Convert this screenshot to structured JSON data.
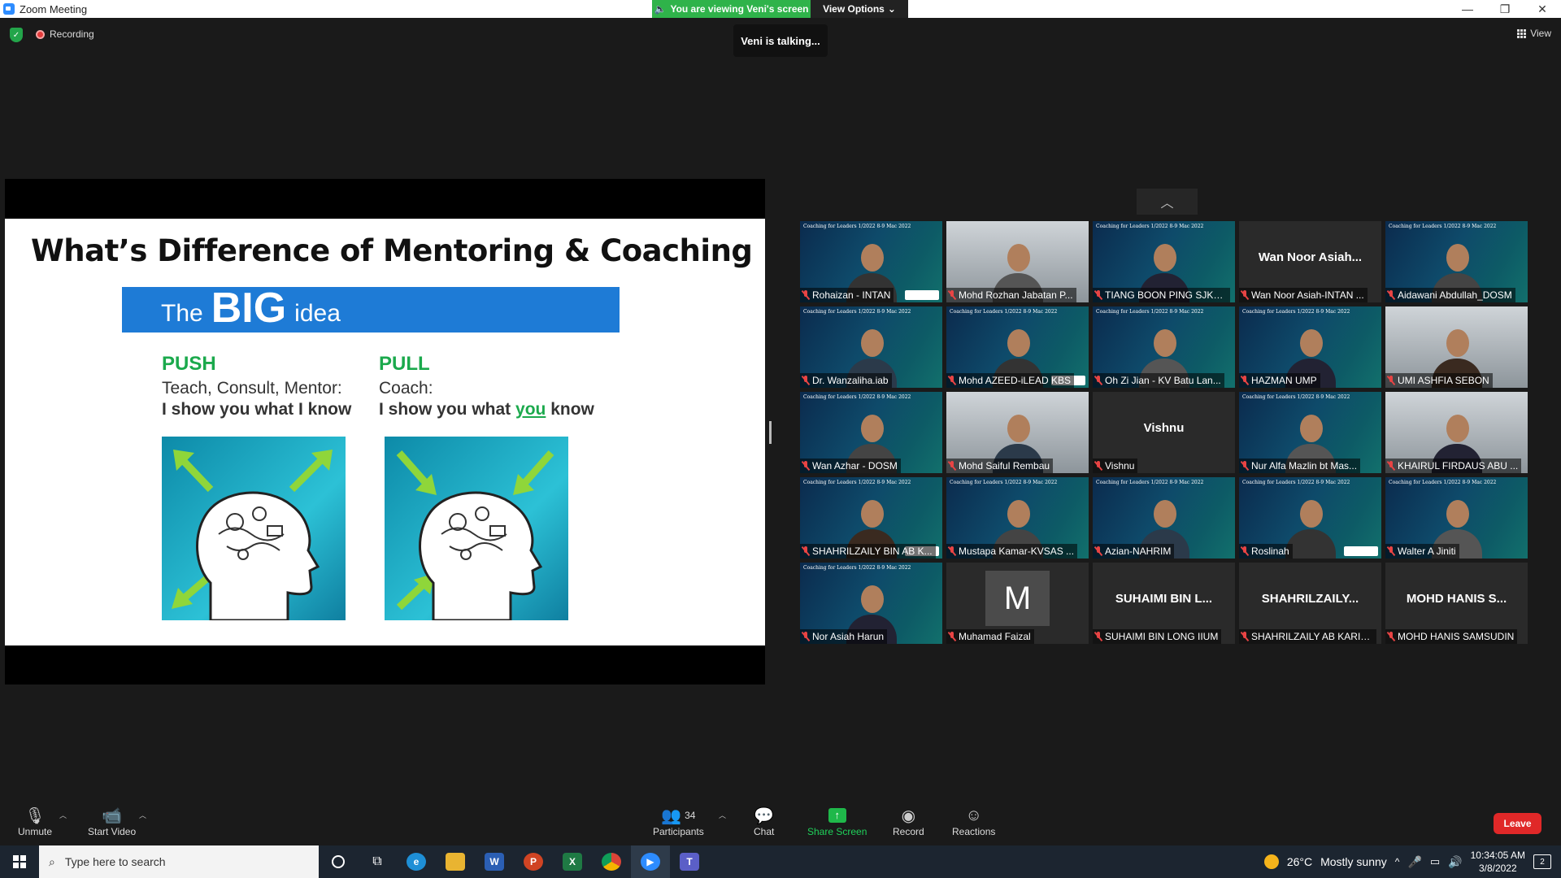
{
  "window": {
    "title": "Zoom Meeting"
  },
  "banner": {
    "viewing_text": "You are viewing Veni's screen",
    "view_options_label": "View Options"
  },
  "status": {
    "recording_label": "Recording",
    "talking_text": "Veni is talking...",
    "view_label": "View"
  },
  "slide": {
    "title": "What’s Difference of Mentoring & Coaching",
    "big_idea": {
      "the": "The",
      "big": "BIG",
      "idea": "idea"
    },
    "push": {
      "head": "PUSH",
      "line1": "Teach, Consult, Mentor:",
      "line2": "I show you what I know"
    },
    "pull": {
      "head": "PULL",
      "line1": "Coach:",
      "line2_pre": "I show you what ",
      "line2_hl": "you",
      "line2_post": " know"
    },
    "banner_text": "Coaching for Leaders 1/2022 8-9 Mac 2022"
  },
  "participants": [
    {
      "name": "Rohaizan - INTAN",
      "style": "bg"
    },
    {
      "name": "Mohd Rozhan Jabatan P...",
      "style": "cam"
    },
    {
      "name": "TIANG BOON PING SJKC...",
      "style": "bg"
    },
    {
      "name": "Wan Noor Asiah-INTAN ...",
      "style": "name",
      "display": "Wan Noor Asiah..."
    },
    {
      "name": "Aidawani Abdullah_DOSM",
      "style": "bg"
    },
    {
      "name": "Dr. Wanzaliha.iab",
      "style": "bg",
      "mic": false
    },
    {
      "name": "Mohd AZEED-iLEAD KBS",
      "style": "bg"
    },
    {
      "name": "Oh Zi Jian - KV Batu Lan...",
      "style": "bg"
    },
    {
      "name": "HAZMAN UMP",
      "style": "bg"
    },
    {
      "name": "UMI ASHFIA SEBON",
      "style": "cam"
    },
    {
      "name": "Wan Azhar - DOSM",
      "style": "bg"
    },
    {
      "name": "Mohd Saiful Rembau",
      "style": "cam"
    },
    {
      "name": "Vishnu",
      "style": "name",
      "display": "Vishnu"
    },
    {
      "name": "Nur Alfa Mazlin bt Mas...",
      "style": "bg"
    },
    {
      "name": "KHAIRUL FIRDAUS ABU ...",
      "style": "cam"
    },
    {
      "name": "SHAHRILZAILY BIN AB K...",
      "style": "bg"
    },
    {
      "name": "Mustapa Kamar-KVSAS ...",
      "style": "bg"
    },
    {
      "name": "Azian-NAHRIM",
      "style": "bg",
      "mic": false
    },
    {
      "name": "Roslinah",
      "style": "bg"
    },
    {
      "name": "Walter A Jiniti",
      "style": "bg"
    },
    {
      "name": "Nor Asiah Harun",
      "style": "bg",
      "mic": false
    },
    {
      "name": "Muhamad Faizal",
      "style": "avatar",
      "display": "M"
    },
    {
      "name": "SUHAIMI BIN LONG IIUM",
      "style": "name",
      "display": "SUHAIMI BIN L..."
    },
    {
      "name": "SHAHRILZAILY AB KARIM...",
      "style": "name",
      "display": "SHAHRILZAILY..."
    },
    {
      "name": "MOHD HANIS SAMSUDIN",
      "style": "name",
      "display": "MOHD HANIS S..."
    }
  ],
  "toolbar": {
    "unmute": "Unmute",
    "start_video": "Start Video",
    "participants": "Participants",
    "participant_count": "34",
    "chat": "Chat",
    "share_screen": "Share Screen",
    "record": "Record",
    "reactions": "Reactions",
    "leave": "Leave"
  },
  "taskbar": {
    "search_placeholder": "Type here to search",
    "weather_temp": "26°C",
    "weather_desc": "Mostly sunny",
    "time": "10:34:05 AM",
    "date": "3/8/2022",
    "notifications": "2"
  },
  "colors": {
    "zoom_blue": "#2d8cff",
    "green": "#1ba94c",
    "leave_red": "#e02828",
    "slide_blue": "#1e7bd6"
  }
}
